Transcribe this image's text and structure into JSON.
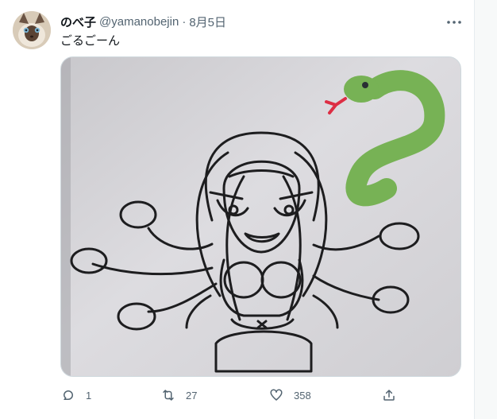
{
  "tweet": {
    "author_name": "のべ子",
    "author_handle": "@yamanobejin",
    "separator": "·",
    "date": "8月5日",
    "text": "ごるごーん"
  },
  "icons": {
    "more": "more-horizontal-icon",
    "reply": "reply-icon",
    "retweet": "retweet-icon",
    "like": "like-icon",
    "share": "share-icon"
  },
  "stats": {
    "replies": "1",
    "retweets": "27",
    "likes": "358"
  },
  "colors": {
    "text_primary": "#0f1419",
    "text_secondary": "#536471",
    "snake_green": "#77b255",
    "tongue_red": "#dd2e44"
  }
}
